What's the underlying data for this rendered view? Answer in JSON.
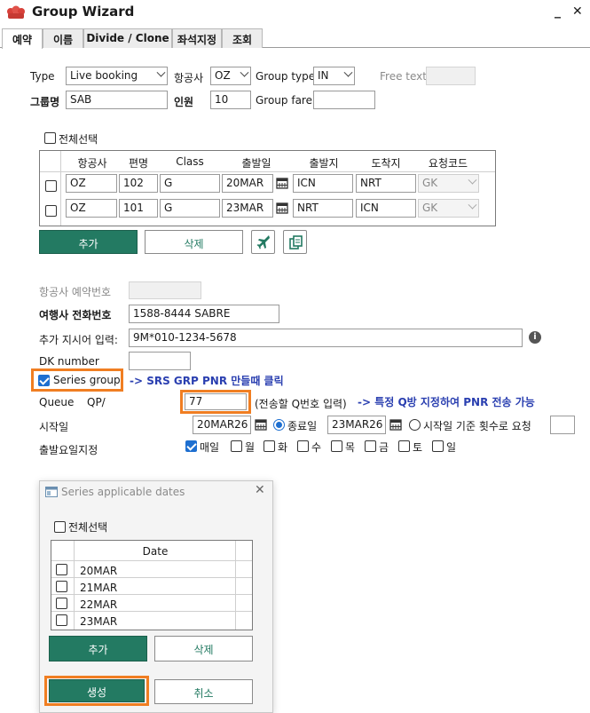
{
  "window": {
    "title": "Group Wizard",
    "minimize": "_",
    "close": "✕"
  },
  "tabs": [
    "예약",
    "이름",
    "Divide / Clone",
    "좌석지정",
    "조회"
  ],
  "form": {
    "type_label": "Type",
    "type_value": "Live booking",
    "airline_label": "항공사",
    "airline_value": "OZ",
    "group_type_label": "Group type",
    "group_type_value": "IN",
    "free_text_label": "Free text",
    "free_text_value": "",
    "group_name_label": "그룹명",
    "group_name_value": "SAB",
    "pax_label": "인원",
    "pax_value": "10",
    "group_fare_label": "Group fare",
    "group_fare_value": ""
  },
  "segments": {
    "select_all_label": "전체선택",
    "headers": [
      "항공사",
      "편명",
      "Class",
      "출발일",
      "출발지",
      "도착지",
      "요청코드"
    ],
    "rows": [
      {
        "airline": "OZ",
        "flight": "102",
        "class": "G",
        "date": "20MAR",
        "origin": "ICN",
        "dest": "NRT",
        "code": "GK"
      },
      {
        "airline": "OZ",
        "flight": "101",
        "class": "G",
        "date": "23MAR",
        "origin": "NRT",
        "dest": "ICN",
        "code": "GK"
      }
    ],
    "add_label": "추가",
    "delete_label": "삭제"
  },
  "details": {
    "airline_pnr_label": "항공사 예약번호",
    "airline_pnr_value": "",
    "agency_phone_label": "여행사 전화번호",
    "agency_phone_value": "1588-8444 SABRE",
    "extra_instr_label": "추가 지시어 입력:",
    "extra_instr_value": "9M*010-1234-5678",
    "dk_label": "DK number",
    "dk_value": "",
    "series_group_label": "Series group",
    "series_note": "-> SRS GRP PNR 만들때 클릭",
    "queue_label": "Queue",
    "qp_label": "QP/",
    "queue_value": "77",
    "queue_hint": "(전송할 Q번호 입력)",
    "queue_note": "-> 특정 Q방 지정하여 PNR 전송 가능",
    "start_label": "시작일",
    "start_value": "20MAR26",
    "end_radio_label": "종료일",
    "end_value": "23MAR26",
    "count_radio_label": "시작일 기준 횟수로 요청",
    "count_value": "",
    "weekday_label": "출발요일지정",
    "weekdays": [
      "매일",
      "월",
      "화",
      "수",
      "목",
      "금",
      "토",
      "일"
    ]
  },
  "dialog": {
    "title": "Series applicable dates",
    "select_all_label": "전체선택",
    "date_header": "Date",
    "dates": [
      "20MAR",
      "21MAR",
      "22MAR",
      "23MAR"
    ],
    "add_label": "추가",
    "delete_label": "삭제",
    "create_label": "생성",
    "cancel_label": "취소"
  }
}
